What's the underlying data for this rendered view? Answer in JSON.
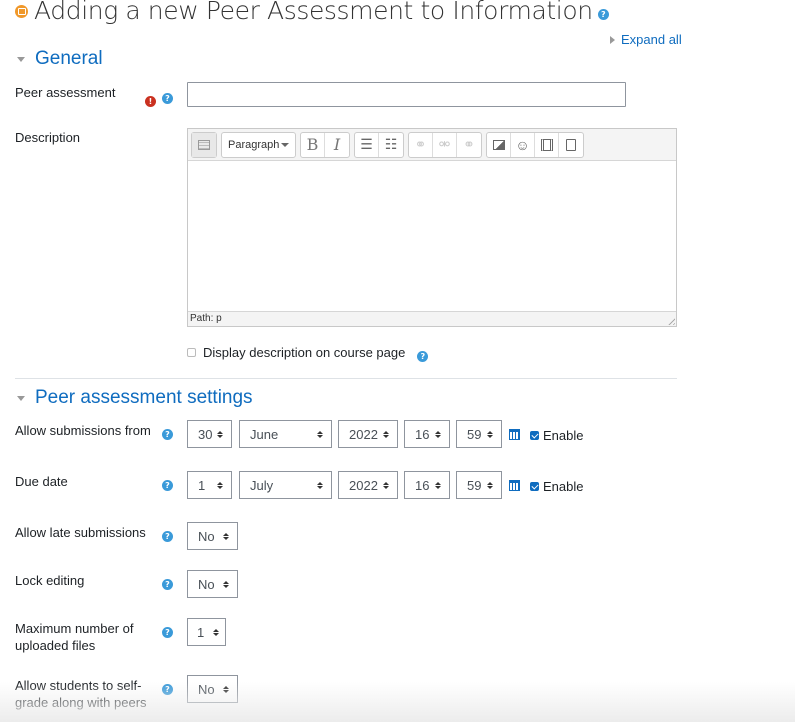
{
  "page": {
    "title": "Adding a new Peer Assessment to Information",
    "expand_all": "Expand all"
  },
  "colors": {
    "link": "#0f6cbf",
    "help_icon": "#3a9ad9",
    "required_icon": "#ca3120",
    "module_icon": "#f0982a"
  },
  "general": {
    "heading": "General",
    "peer_assessment_label": "Peer assessment",
    "peer_assessment_value": "",
    "description_label": "Description",
    "editor": {
      "block_format": "Paragraph",
      "bold": "B",
      "italic": "I",
      "path": "Path: p"
    },
    "display_description_label": "Display description on course page",
    "display_description_checked": false
  },
  "settings": {
    "heading": "Peer assessment settings",
    "allow_submissions_from": {
      "label": "Allow submissions from",
      "day": "30",
      "month": "June",
      "year": "2022",
      "hour": "16",
      "minute": "59",
      "enable_label": "Enable",
      "enabled": true
    },
    "due_date": {
      "label": "Due date",
      "day": "1",
      "month": "July",
      "year": "2022",
      "hour": "16",
      "minute": "59",
      "enable_label": "Enable",
      "enabled": true
    },
    "allow_late": {
      "label": "Allow late submissions",
      "value": "No"
    },
    "lock_editing": {
      "label": "Lock editing",
      "value": "No"
    },
    "max_files": {
      "label_line1": "Maximum number of",
      "label_line2": "uploaded files",
      "value": "1"
    },
    "self_grade": {
      "label_line1": "Allow students to self-",
      "label_line2": "grade along with peers",
      "value": "No"
    }
  }
}
